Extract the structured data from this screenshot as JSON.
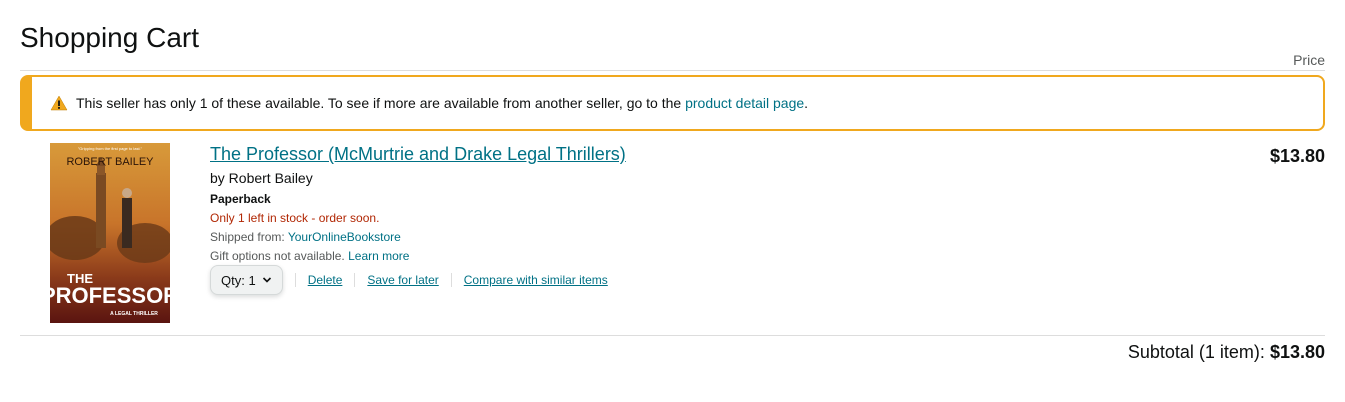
{
  "page": {
    "title": "Shopping Cart",
    "price_header": "Price"
  },
  "alert": {
    "message": "This seller has only 1 of these available. To see if more are available from another seller, go to the",
    "link_text": "product detail page",
    "period": ".",
    "icon": "warning-icon",
    "border_color": "#f0a81e"
  },
  "item": {
    "cover": {
      "author_top": "ROBERT BAILEY",
      "tagline": "\"Gripping from the first page to last.\"",
      "title_line1": "THE",
      "title_line2": "PROFESSOR",
      "subtitle": "A LEGAL THRILLER"
    },
    "title": "The Professor (McMurtrie and Drake Legal Thrillers)",
    "author": "by Robert Bailey",
    "format": "Paperback",
    "stock": "Only 1 left in stock - order soon.",
    "shipped_label": "Shipped from: ",
    "shipped_seller": "YourOnlineBookstore",
    "gift_text": "Gift options not available.",
    "gift_link": "Learn more",
    "qty_label": "Qty:",
    "qty_value": "1",
    "delete_label": "Delete",
    "save_label": "Save for later",
    "compare_label": "Compare with similar items",
    "price": "$13.80"
  },
  "subtotal": {
    "label": "Subtotal (1 item):",
    "amount": "$13.80"
  },
  "colors": {
    "link": "#007185",
    "stock": "#b12704",
    "alert": "#f0a81e"
  }
}
